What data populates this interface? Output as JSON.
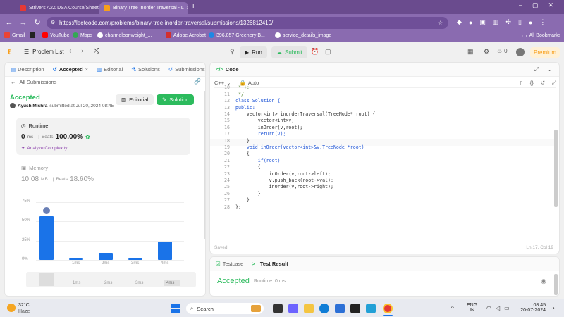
{
  "browser": {
    "tabs": [
      {
        "title": "Strivers A2Z DSA Course/Sheet",
        "favicon_color": "#e53935"
      },
      {
        "title": "Binary Tree Inorder Traversal - L",
        "favicon_color": "#f89f1b"
      }
    ],
    "new_tab_icon": "plus-icon",
    "url": "https://leetcode.com/problems/binary-tree-inorder-traversal/submissions/1326812410/",
    "bookmarks": [
      "Gmail",
      "YouTube",
      "Maps",
      "charmeleonweight_...",
      "Adobe Acrobat",
      "396,057 Greenery B...",
      "service_details_image"
    ],
    "all_bookmarks": "All Bookmarks"
  },
  "lc": {
    "problem_list": "Problem List",
    "run": "Run",
    "submit": "Submit",
    "notif_count": "0",
    "premium": "Premium"
  },
  "left": {
    "tabs": [
      "Description",
      "Accepted",
      "Editorial",
      "Solutions",
      "Submissions"
    ],
    "all_submissions": "All Submissions",
    "status": "Accepted",
    "user": "Ayush Mishra",
    "submitted": "submitted at Jul 20, 2024 08:45",
    "editorial_btn": "Editorial",
    "solution_btn": "Solution",
    "runtime_label": "Runtime",
    "runtime_value": "0",
    "runtime_unit": "ms",
    "beats_label": "Beats",
    "runtime_beats": "100.00%",
    "analyze": "Analyze Complexity",
    "memory_label": "Memory",
    "memory_value": "10.08",
    "memory_unit": "MB",
    "memory_beats": "18.60%",
    "accent": "#2cbb5d"
  },
  "chart_data": {
    "type": "bar",
    "y_ticks": [
      "75%",
      "50%",
      "25%",
      "0%"
    ],
    "ylim": [
      0,
      75
    ],
    "categories": [
      "0ms",
      "1ms",
      "2ms",
      "3ms",
      "4ms"
    ],
    "values": [
      57,
      2,
      9,
      2,
      24
    ],
    "highlighted": "0ms"
  },
  "memory_chart_labels": [
    "1ms",
    "2ms",
    "3ms",
    "4ms"
  ],
  "editor": {
    "title": "Code",
    "language": "C++",
    "mode": "Auto",
    "saved": "Saved",
    "cursor": "Ln 17, Col 19",
    "lines": [
      {
        "n": "",
        "t": "    TreeNode(int x, TreeNode *left, TreeNode *right) : val(x), left(left), right(right) {}"
      },
      {
        "n": "10",
        "t": " * };"
      },
      {
        "n": "11",
        "t": " */"
      },
      {
        "n": "12",
        "t": "class Solution {"
      },
      {
        "n": "13",
        "t": "public:"
      },
      {
        "n": "14",
        "t": "    vector<int> inorderTraversal(TreeNode* root) {"
      },
      {
        "n": "15",
        "t": "        vector<int>v;"
      },
      {
        "n": "16",
        "t": "        inOrder(v,root);"
      },
      {
        "n": "17",
        "t": "        return(v);"
      },
      {
        "n": "18",
        "t": "    }"
      },
      {
        "n": "19",
        "t": "    void inOrder(vector<int>&v,TreeNode *root)"
      },
      {
        "n": "20",
        "t": "    {"
      },
      {
        "n": "21",
        "t": "        if(root)"
      },
      {
        "n": "22",
        "t": "        {"
      },
      {
        "n": "23",
        "t": "            inOrder(v,root->left);"
      },
      {
        "n": "24",
        "t": "            v.push_back(root->val);"
      },
      {
        "n": "25",
        "t": "            inOrder(v,root->right);"
      },
      {
        "n": "26",
        "t": "        }"
      },
      {
        "n": "27",
        "t": "    }"
      },
      {
        "n": "28",
        "t": "};"
      }
    ]
  },
  "testpanel": {
    "testcase": "Testcase",
    "test_result": "Test Result",
    "accepted": "Accepted",
    "runtime": "Runtime: 0 ms"
  },
  "taskbar": {
    "temp": "32°C",
    "weather": "Haze",
    "search": "Search",
    "lang1": "ENG",
    "lang2": "IN",
    "time": "08:45",
    "date": "20-07-2024"
  }
}
